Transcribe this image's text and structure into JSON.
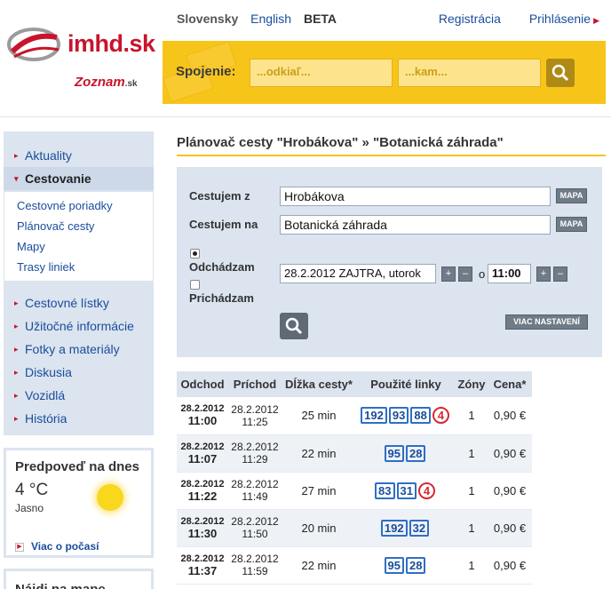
{
  "header": {
    "logo_text": "imhd.sk",
    "partner_logo": "Zoznam",
    "partner_suffix": ".sk",
    "languages": [
      "Slovensky",
      "English"
    ],
    "beta_label": "BETA",
    "register": "Registrácia",
    "login": "Prihlásenie"
  },
  "search": {
    "label": "Spojenie:",
    "from_placeholder": "...odkiaľ...",
    "to_placeholder": "...kam..."
  },
  "sidebar": {
    "items": [
      {
        "label": "Aktuality"
      },
      {
        "label": "Cestovanie"
      }
    ],
    "sub_items": [
      "Cestovné poriadky",
      "Plánovač cesty",
      "Mapy",
      "Trasy liniek"
    ],
    "items2": [
      "Cestovné lístky",
      "Užitočné informácie",
      "Fotky a materiály",
      "Diskusia",
      "Vozidlá",
      "História"
    ]
  },
  "weather": {
    "title": "Predpoveď na dnes",
    "temperature": "4 °C",
    "condition": "Jasno",
    "more_link": "Viac o počasí"
  },
  "map_box": {
    "title": "Nájdi na mape"
  },
  "planner": {
    "title": "Plánovač cesty \"Hrobákova\" » \"Botanická záhrada\"",
    "from_label": "Cestujem z",
    "from_value": "Hrobákova",
    "to_label": "Cestujem na",
    "to_value": "Botanická záhrada",
    "map_button": "MAPA",
    "depart_label": "Odchádzam",
    "arrive_label": "Prichádzam",
    "date_value": "28.2.2012 ZAJTRA, utorok",
    "or_label": "o",
    "time_value": "11:00",
    "plus": "+",
    "minus": "–",
    "more_settings": "VIAC NASTAVENÍ"
  },
  "results": {
    "headers": [
      "Odchod",
      "Príchod",
      "Dĺžka cesty*",
      "Použité linky",
      "Zóny",
      "Cena*"
    ],
    "rows": [
      {
        "dep_date": "28.2.2012",
        "dep_time": "11:00",
        "arr_date": "28.2.2012",
        "arr_time": "11:25",
        "duration": "25 min",
        "lines": [
          "192",
          "93",
          "88"
        ],
        "night": [
          "4"
        ],
        "zones": "1",
        "price": "0,90 €"
      },
      {
        "dep_date": "28.2.2012",
        "dep_time": "11:07",
        "arr_date": "28.2.2012",
        "arr_time": "11:29",
        "duration": "22 min",
        "lines": [
          "95",
          "28"
        ],
        "night": [],
        "zones": "1",
        "price": "0,90 €"
      },
      {
        "dep_date": "28.2.2012",
        "dep_time": "11:22",
        "arr_date": "28.2.2012",
        "arr_time": "11:49",
        "duration": "27 min",
        "lines": [
          "83",
          "31"
        ],
        "night": [
          "4"
        ],
        "zones": "1",
        "price": "0,90 €"
      },
      {
        "dep_date": "28.2.2012",
        "dep_time": "11:30",
        "arr_date": "28.2.2012",
        "arr_time": "11:50",
        "duration": "20 min",
        "lines": [
          "192",
          "32"
        ],
        "night": [],
        "zones": "1",
        "price": "0,90 €"
      },
      {
        "dep_date": "28.2.2012",
        "dep_time": "11:37",
        "arr_date": "28.2.2012",
        "arr_time": "11:59",
        "duration": "22 min",
        "lines": [
          "95",
          "28"
        ],
        "night": [],
        "zones": "1",
        "price": "0,90 €"
      }
    ]
  },
  "colors": {
    "brand_red": "#c8142c",
    "accent_yellow": "#f7c51a",
    "link_blue": "#1a4d9c",
    "panel_blue": "#dbe4ef"
  }
}
